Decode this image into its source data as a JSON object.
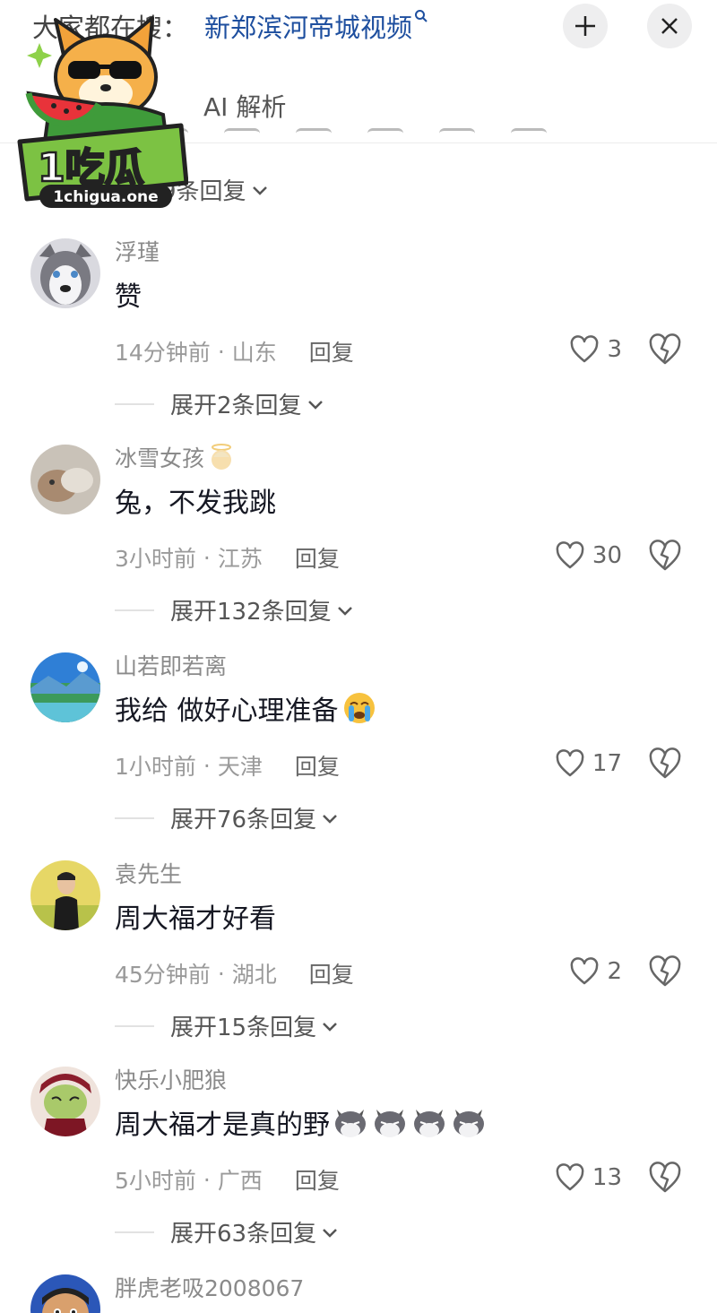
{
  "header": {
    "search_prefix": "大家都在搜：",
    "search_term": "新郑滨河帝城视频",
    "ai_tab": "AI 解析"
  },
  "logo": {
    "brand": "1吃瓜",
    "url": "1chigua.one"
  },
  "first_expand": "展开9条回复",
  "comments": [
    {
      "user": "浮瑾",
      "text": "赞",
      "time": "14分钟前",
      "region": "山东",
      "reply": "回复",
      "likes": "3",
      "expand": "展开2条回复"
    },
    {
      "user": "冰雪女孩",
      "text": "兔，不发我跳",
      "time": "3小时前",
      "region": "江苏",
      "reply": "回复",
      "likes": "30",
      "expand": "展开132条回复"
    },
    {
      "user": "山若即若离",
      "text": "我给 做好心理准备",
      "time": "1小时前",
      "region": "天津",
      "reply": "回复",
      "likes": "17",
      "expand": "展开76条回复"
    },
    {
      "user": "袁先生",
      "text": "周大福才好看",
      "time": "45分钟前",
      "region": "湖北",
      "reply": "回复",
      "likes": "2",
      "expand": "展开15条回复"
    },
    {
      "user": "快乐小肥狼",
      "text": "周大福才是真的野",
      "time": "5小时前",
      "region": "广西",
      "reply": "回复",
      "likes": "13",
      "expand": "展开63条回复"
    }
  ],
  "last_comment_user": "胖虎老吸2008067",
  "colors": {
    "search_term": "#1e4f9f",
    "text": "#161823",
    "meta": "#9a9a9a"
  }
}
